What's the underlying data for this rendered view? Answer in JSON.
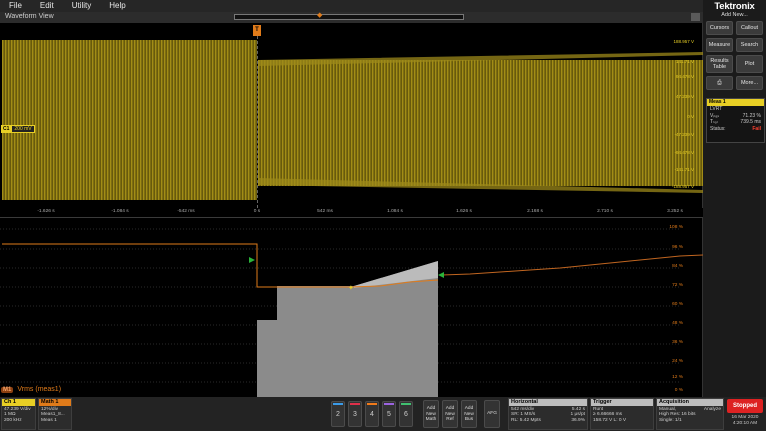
{
  "menu": [
    "File",
    "Edit",
    "Utility",
    "Help"
  ],
  "waveform_view": {
    "title": "Waveform View",
    "trigger_marker": "T"
  },
  "ch1": {
    "badge_num": "C1",
    "badge_scale": "200 mV",
    "color": "#e8cf25",
    "right_labels": [
      "188.957 V",
      "141.71 V",
      "94.478 V",
      "47.239 V",
      "0 V",
      "-47.239 V",
      "-94.478 V",
      "-141.71 V",
      "-188.957 V"
    ]
  },
  "time_ticks": [
    "-1.626 s",
    "-1.084 s",
    "-542 ms",
    "0 s",
    "542 ms",
    "1.084 s",
    "1.626 s",
    "2.168 s",
    "2.710 s",
    "3.252 s"
  ],
  "math": {
    "badge": "M1",
    "title": "Vrms (meas1)",
    "color": "#e07b1a",
    "right_labels": [
      "108 %",
      "96 %",
      "84 %",
      "72 %",
      "60 %",
      "48 %",
      "36 %",
      "24 %",
      "12 %",
      "0 %"
    ]
  },
  "right_panel": {
    "brand": "Tektronix",
    "add_new": "Add New...",
    "buttons": [
      "Cursors",
      "Callout",
      "Measure",
      "Search",
      "Results Table",
      "Plot",
      "",
      "More..."
    ],
    "meas": {
      "title": "Meas 1",
      "name": "LVRT",
      "row1_label": "Vₚₐₛ",
      "row1_value": "71.23 %",
      "row2_label": "Tₛₒₗ",
      "row2_value": "739.5 ms",
      "status_label": "Status:",
      "status_value": "Fail"
    }
  },
  "bottom": {
    "ch1": {
      "title": "Ch 1",
      "lines": [
        "47.239 V/div",
        "1 MΩ",
        "200 kHz"
      ]
    },
    "math1": {
      "title": "Math 1",
      "lines": [
        "12%/div",
        "Meas1_8...",
        "Meas 1"
      ]
    },
    "channels": [
      "2",
      "3",
      "4",
      "5",
      "6"
    ],
    "channel_colors": [
      "#3a9be8",
      "#e0304a",
      "#f07a1a",
      "#9b63e0",
      "#40c070"
    ],
    "add_math": "Add New Math",
    "add_ref": "Add New Ref",
    "add_bus": "Add New Bus",
    "afg": "AFG",
    "horizontal": {
      "title": "Horizontal",
      "lines": [
        "542 ms/div",
        "SR: 1 MS/s",
        "RL: 5.42 Mpts"
      ],
      "right": [
        "5.42 s",
        "1 μs/pt",
        "36.9%"
      ]
    },
    "trigger": {
      "title": "Trigger",
      "lines": [
        "Runt",
        "≥ 6.66666 ms",
        "158.72 V  L: 0 V"
      ]
    },
    "acquisition": {
      "title": "Acquisition",
      "lines": [
        "Manual,",
        "High Res: 16 bits",
        "Single: 1/1"
      ],
      "right": [
        "Analyze"
      ]
    },
    "stopped": "Stopped",
    "date": "16 Mar 2020",
    "time": "4:20:10 AM"
  }
}
